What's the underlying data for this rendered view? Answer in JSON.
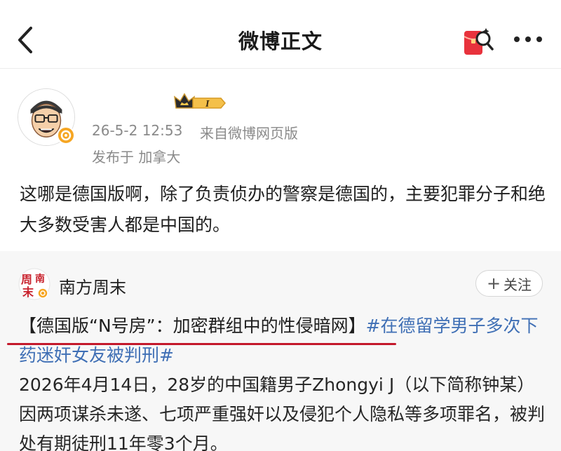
{
  "nav": {
    "title": "微博正文"
  },
  "post": {
    "crown_level": "I",
    "time": "26-5-2 12:53",
    "source": "来自微博网页版",
    "location": "发布于 加拿大",
    "text": "这哪是德国版啊，除了负责侦办的警察是德国的，主要犯罪分子和绝大多数受害人都是中国的。"
  },
  "repost": {
    "author": "南方周末",
    "logo_chars": [
      "周",
      "南",
      "末"
    ],
    "follow_label": "关注",
    "headline": "【德国版“N号房”：加密群组中的性侵暗网】",
    "hashtag": "#在德留学男子多次下药迷奸女友被判刑#",
    "body": "2026年4月14日，28岁的中国籍男子Zhongyi J（以下简称钟某）因两项谋杀未遂、七项严重强奸以及侵犯个人隐私等多项罪名，被判处有期徒刑11年零3个月。"
  },
  "colors": {
    "hashtag": "#3f6fb5",
    "underline": "#c4192b",
    "repost_bg": "#f7f7f7",
    "verified_badge": "#f6a623"
  },
  "icons": [
    "back-arrow-icon",
    "red-packet-icon",
    "more-dots-icon",
    "crown-level-badge",
    "verified-icon"
  ]
}
